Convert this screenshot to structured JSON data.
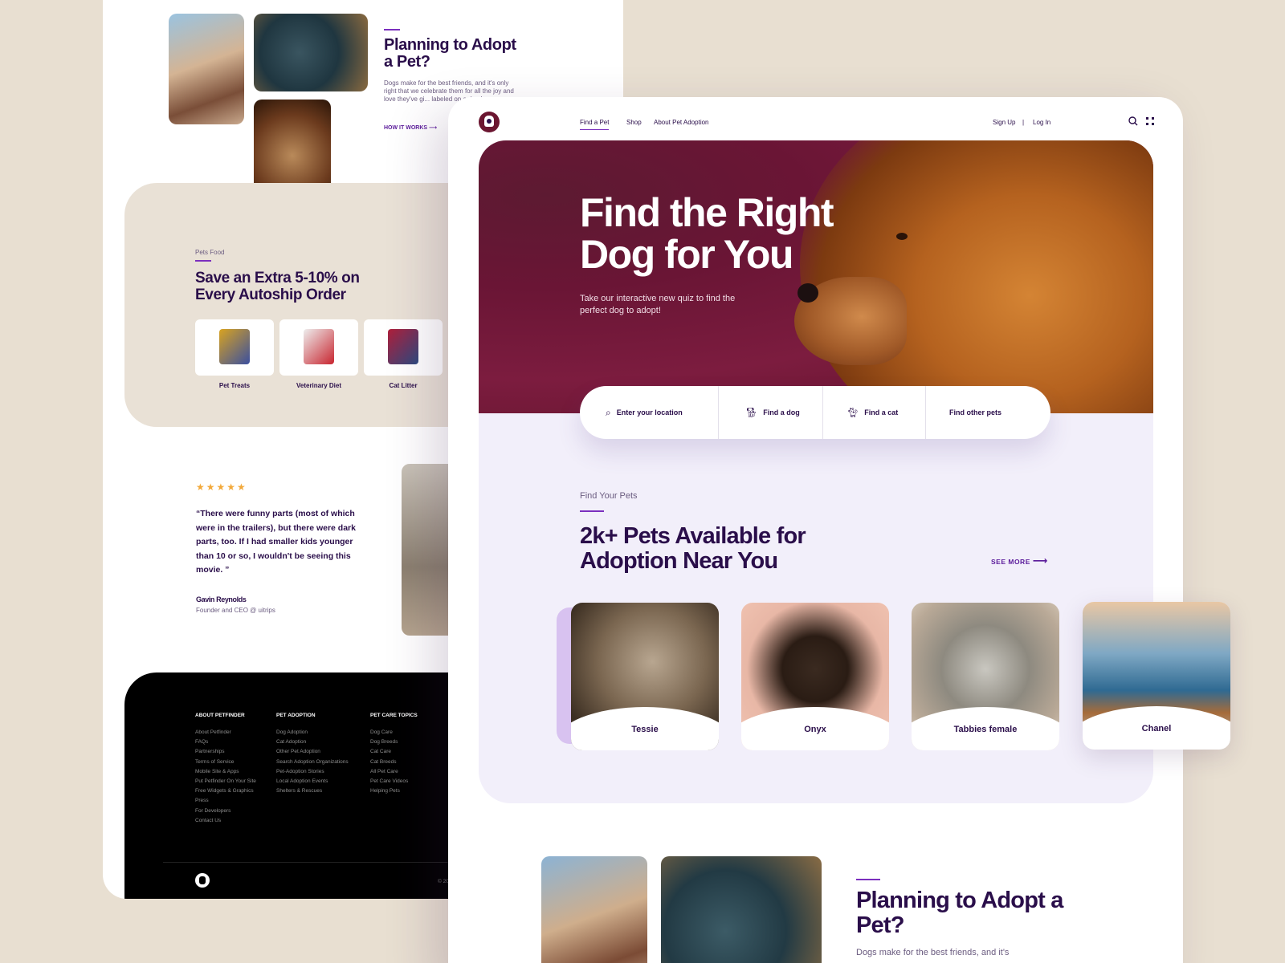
{
  "back": {
    "planning": {
      "title": "Planning to Adopt a Pet?",
      "body": "Dogs make for the best friends, and it's only right that we celebrate them for all the joy and love they've gi... labeled on a dog be...",
      "link": "HOW IT WORKS"
    },
    "food": {
      "eyebrow": "Pets Food",
      "title": "Save an Extra 5-10% on Every Autoship Order",
      "products": [
        "Pet Treats",
        "Veterinary Diet",
        "Cat Litter"
      ]
    },
    "review": {
      "stars": "★★★★★",
      "quote": "“There were funny parts (most of which were in the trailers), but there were dark parts, too. If I had smaller kids younger than 10 or so, I wouldn't be seeing this movie. ”",
      "author": "Gavin Reynolds",
      "role": "Founder and CEO @ uitrips"
    },
    "footer": {
      "columns": [
        {
          "heading": "ABOUT PETFINDER",
          "items": [
            "About Petfinder",
            "FAQs",
            "Partnerships",
            "Terms of Service",
            "Mobile Site & Apps",
            "Put Petfinder On Your Site",
            "Free Widgets & Graphics",
            "Press",
            "For Developers",
            "Contact Us"
          ]
        },
        {
          "heading": "PET ADOPTION",
          "items": [
            "Dog Adoption",
            "Cat Adoption",
            "Other Pet Adoption",
            "Search Adoption Organizations",
            "Pet-Adoption Stories",
            "Local Adoption Events",
            "Shelters & Rescues"
          ]
        },
        {
          "heading": "PET CARE TOPICS",
          "items": [
            "Dog Care",
            "Dog Breeds",
            "Cat Care",
            "Cat Breeds",
            "All Pet Care",
            "Pet Care Videos",
            "Helping Pets"
          ]
        }
      ],
      "copyright": "© 2019. All ri"
    }
  },
  "nav": {
    "links": [
      "Find a Pet",
      "Shop",
      "About Pet Adoption"
    ],
    "signup": "Sign Up",
    "separator": "|",
    "login": "Log In"
  },
  "hero": {
    "title": "Find the Right Dog for You",
    "subtitle": "Take our interactive new quiz to find the perfect dog to adopt!"
  },
  "search": {
    "location_placeholder": "Enter your location",
    "find_dog": "Find a dog",
    "find_cat": "Find a cat",
    "find_other": "Find other pets"
  },
  "pets": {
    "eyebrow": "Find Your Pets",
    "title": "2k+ Pets Available for Adoption Near You",
    "see_more": "SEE MORE",
    "cards": [
      "Tessie",
      "Onyx",
      "Tabbies female",
      "Chanel"
    ]
  },
  "planning_front": {
    "title": "Planning to Adopt a Pet?",
    "body": "Dogs make for the best friends, and it's"
  },
  "colors": {
    "accent": "#7b2fbe",
    "primary_text": "#2a0e4a",
    "hero": "#6a1535",
    "background": "#e8dfd1",
    "star": "#f2a93b"
  }
}
